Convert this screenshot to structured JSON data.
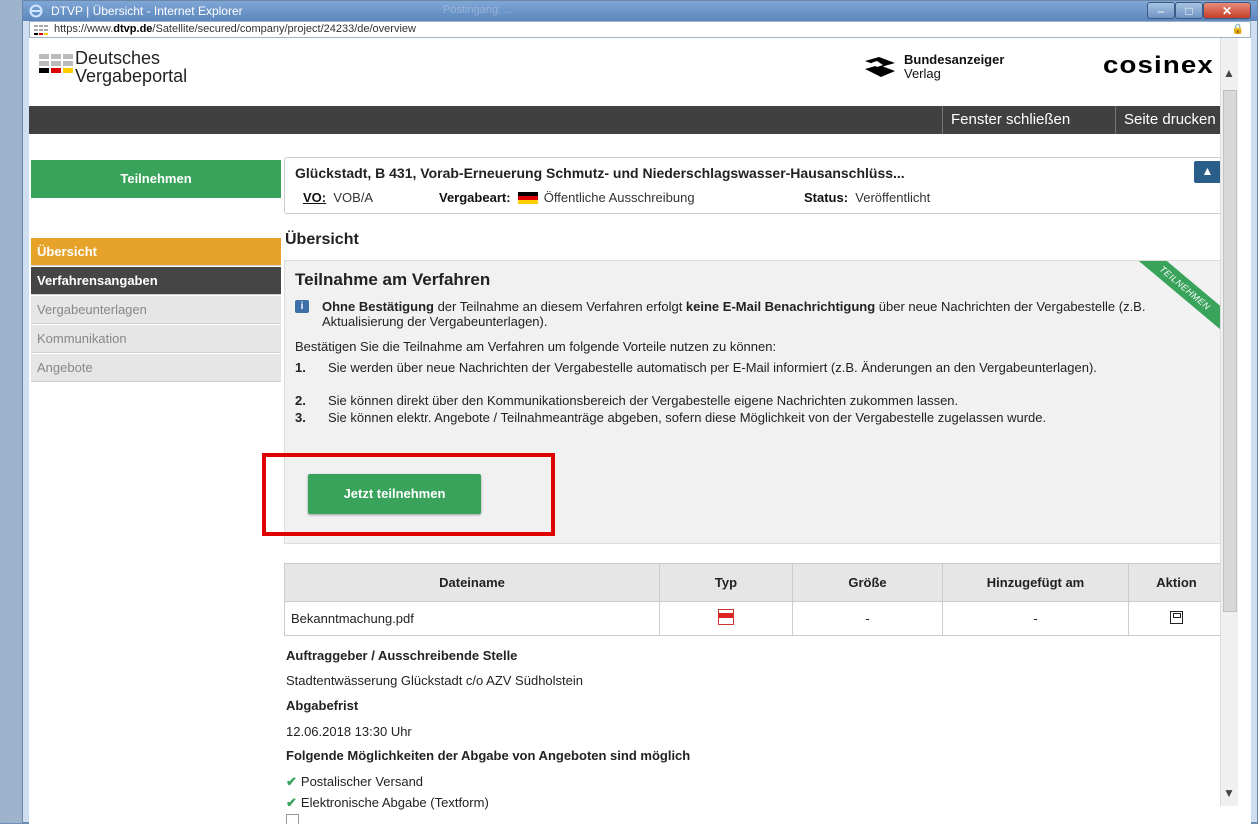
{
  "window": {
    "title": "DTVP | Übersicht - Internet Explorer",
    "other_window": "Postingang: ...",
    "url_prefix": "https://www.",
    "url_domain": "dtvp.de",
    "url_rest": "/Satellite/secured/company/project/24233/de/overview"
  },
  "header": {
    "logo_line1": "Deutsches",
    "logo_line2": "Vergabeportal",
    "partner1_line1": "Bundesanzeiger",
    "partner1_line2": "Verlag",
    "partner2": "cosinex",
    "close_label": "Fenster schließen",
    "print_label": "Seite drucken"
  },
  "sidebar": {
    "participate_label": "Teilnehmen",
    "items": [
      {
        "label": "Übersicht"
      },
      {
        "label": "Verfahrensangaben"
      },
      {
        "label": "Vergabeunterlagen"
      },
      {
        "label": "Kommunikation"
      },
      {
        "label": "Angebote"
      }
    ]
  },
  "project": {
    "title": "Glückstadt, B 431, Vorab-Erneuerung Schmutz- und Niederschlagswasser-Hausanschlüss...",
    "vo_label": "VO:",
    "vo_value": "VOB/A",
    "vergabeart_label": "Vergabeart:",
    "vergabeart_value": "Öffentliche Ausschreibung",
    "status_label": "Status:",
    "status_value": "Veröffentlicht"
  },
  "overview": {
    "heading": "Übersicht",
    "panel_title": "Teilnahme am Verfahren",
    "ribbon": "TEILNEHMEN",
    "info_icon_text": "i",
    "notice_b1": "Ohne Bestätigung",
    "notice_t1": " der Teilnahme an diesem Verfahren erfolgt ",
    "notice_b2": "keine E-Mail Benachrichtigung",
    "notice_t2": " über neue Nachrichten der Vergabestelle (z.B. Aktualisierung der Vergabeunterlagen).",
    "intro": "Bestätigen Sie die Teilnahme am Verfahren um folgende Vorteile nutzen zu können:",
    "benefits": [
      {
        "num": "1.",
        "text": "Sie werden über neue Nachrichten der Vergabestelle automatisch per E-Mail informiert (z.B. Änderungen an den Vergabeunterlagen)."
      },
      {
        "num": "2.",
        "text": "Sie können direkt über den Kommunikationsbereich der Vergabestelle eigene Nachrichten zukommen lassen."
      },
      {
        "num": "3.",
        "text": "Sie können elektr. Angebote / Teilnahmeanträge abgeben, sofern diese Möglichkeit von der Vergabestelle zugelassen wurde."
      }
    ],
    "join_button": "Jetzt teilnehmen"
  },
  "files": {
    "columns": [
      "Dateiname",
      "Typ",
      "Größe",
      "Hinzugefügt am",
      "Aktion"
    ],
    "rows": [
      {
        "name": "Bekanntmachung.pdf",
        "type_icon": "pdf-icon",
        "size": "-",
        "added": "-",
        "action_icon": "save-icon"
      }
    ]
  },
  "details": {
    "client_heading": "Auftraggeber / Ausschreibende Stelle",
    "client_value": "Stadtentwässerung Glückstadt c/o AZV Südholstein",
    "deadline_heading": "Abgabefrist",
    "deadline_value": "12.06.2018 13:30 Uhr",
    "options_heading": "Folgende Möglichkeiten der Abgabe von Angeboten sind möglich",
    "options": [
      "Postalischer Versand",
      "Elektronische Abgabe (Textform)"
    ],
    "check_glyph": "✔"
  },
  "colors": {
    "green": "#3aa35b",
    "orange": "#e7a22a",
    "dark": "#404040",
    "highlight": "#e00000",
    "collapse_blue": "#2b5d8a"
  }
}
